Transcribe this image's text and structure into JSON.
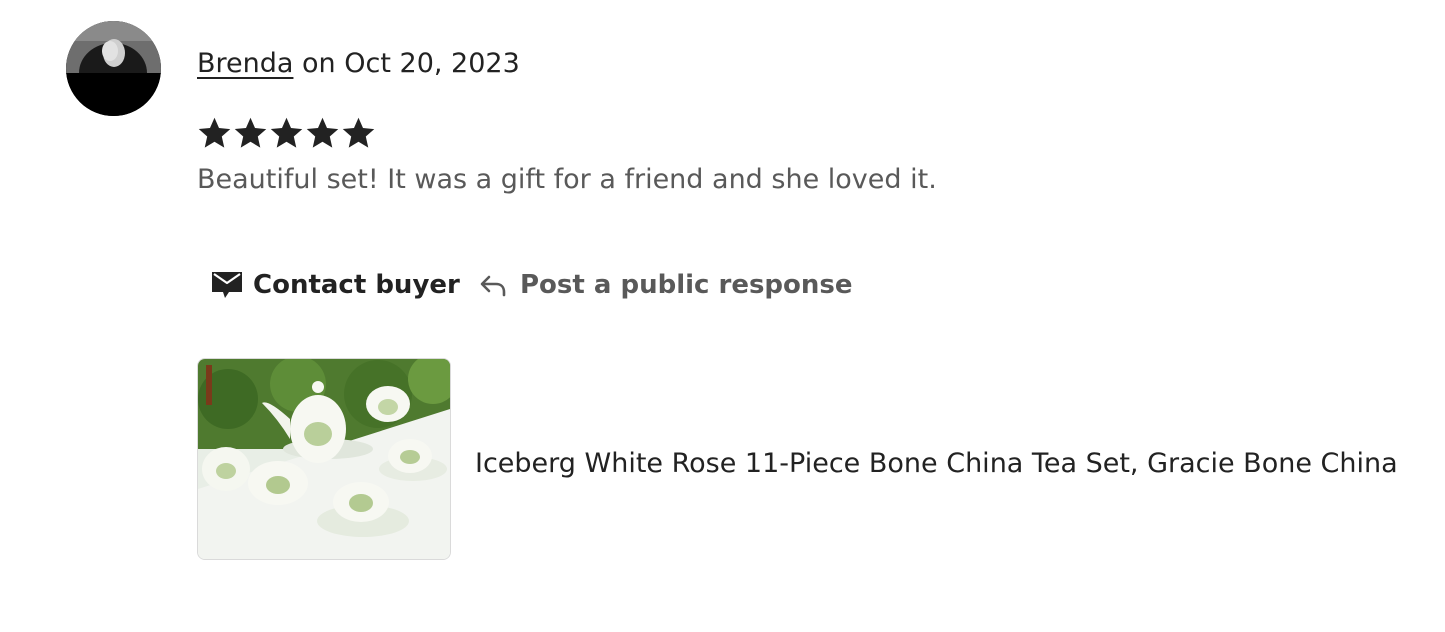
{
  "review": {
    "reviewer_name": "Brenda",
    "date_text": " on Oct 20, 2023",
    "rating": 5,
    "rating_max": 5,
    "text": "Beautiful set! It was a gift for a friend and she loved it."
  },
  "actions": {
    "contact_label": "Contact buyer",
    "respond_label": "Post a public response"
  },
  "product": {
    "title": "Iceberg White Rose 11-Piece Bone China Tea Set, Gracie Bone China"
  },
  "colors": {
    "primary_text": "#222222",
    "secondary_text": "#595959",
    "star": "#222222"
  }
}
